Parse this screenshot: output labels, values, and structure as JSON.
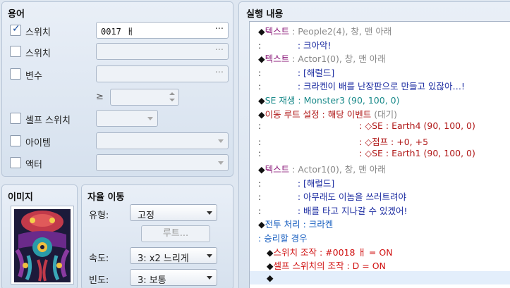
{
  "terms": {
    "title": "용어",
    "switch1": {
      "label": "스위치",
      "checked": true,
      "value": "0017 ㅐ"
    },
    "switch2": {
      "label": "스위치"
    },
    "variable": {
      "label": "변수",
      "ge": "≥"
    },
    "self_switch": {
      "label": "셀프 스위치"
    },
    "item": {
      "label": "아이템"
    },
    "actor": {
      "label": "액터"
    },
    "dots": "···"
  },
  "image": {
    "title": "이미지"
  },
  "autonomous": {
    "title": "자율 이동",
    "type_label": "유형:",
    "type_value": "고정",
    "route_button": "루트...",
    "speed_label": "속도:",
    "speed_value": "3: x2 느리게",
    "freq_label": "빈도:",
    "freq_value": "3: 보통"
  },
  "contents": {
    "title": "실행 내용",
    "lines": [
      {
        "parts": [
          {
            "t": "◆",
            "c": "#111"
          },
          {
            "t": "텍스트",
            "c": "#8b1a7a"
          },
          {
            "t": " : People2(4), 창, 맨 아래",
            "c": "#888"
          }
        ]
      },
      {
        "parts": [
          {
            "t": ":",
            "c": "#333"
          },
          {
            "t": "             : 크아악!",
            "c": "#1a2aa0"
          }
        ]
      },
      {
        "parts": [
          {
            "t": "◆",
            "c": "#111"
          },
          {
            "t": "텍스트",
            "c": "#8b1a7a"
          },
          {
            "t": " : Actor1(0), 창, 맨 아래",
            "c": "#888"
          }
        ]
      },
      {
        "parts": [
          {
            "t": ":",
            "c": "#333"
          },
          {
            "t": "             : [해럴드]",
            "c": "#1a2aa0"
          }
        ]
      },
      {
        "parts": [
          {
            "t": ":",
            "c": "#333"
          },
          {
            "t": "             : 크라켄이 배를 난장판으로 만들고 있잖아…!",
            "c": "#1a2aa0"
          }
        ]
      },
      {
        "parts": [
          {
            "t": "◆",
            "c": "#111"
          },
          {
            "t": "SE 재생 : Monster3 (90, 100, 0)",
            "c": "#1a8a8a"
          }
        ]
      },
      {
        "parts": [
          {
            "t": "◆",
            "c": "#111"
          },
          {
            "t": "이동 루트 설정 : 해당 이벤트",
            "c": "#b01818"
          },
          {
            "t": " (대기)",
            "c": "#888"
          }
        ]
      },
      {
        "parts": [
          {
            "t": ":",
            "c": "#333"
          },
          {
            "t": "                                   : ◇SE : Earth4 (90, 100, 0)",
            "c": "#b01818"
          }
        ]
      },
      {
        "parts": [
          {
            "t": ":",
            "c": "#333"
          },
          {
            "t": "                                   : ◇점프 : +0, +5",
            "c": "#b01818"
          }
        ]
      },
      {
        "parts": [
          {
            "t": ":",
            "c": "#333"
          },
          {
            "t": "                                   : ◇SE : Earth1 (90, 100, 0)",
            "c": "#b01818"
          }
        ]
      },
      {
        "parts": [
          {
            "t": "◆",
            "c": "#111"
          },
          {
            "t": "텍스트",
            "c": "#8b1a7a"
          },
          {
            "t": " : Actor1(0), 창, 맨 아래",
            "c": "#888"
          }
        ]
      },
      {
        "parts": [
          {
            "t": ":",
            "c": "#333"
          },
          {
            "t": "             : [해럴드]",
            "c": "#1a2aa0"
          }
        ]
      },
      {
        "parts": [
          {
            "t": ":",
            "c": "#333"
          },
          {
            "t": "             : 아무래도 이놈을 쓰러트려야",
            "c": "#1a2aa0"
          }
        ]
      },
      {
        "parts": [
          {
            "t": ":",
            "c": "#333"
          },
          {
            "t": "             : 배를 타고 지나갈 수 있겠어!",
            "c": "#1a2aa0"
          }
        ]
      },
      {
        "parts": [
          {
            "t": "◆",
            "c": "#111"
          },
          {
            "t": "전투 처리 : 크라켄",
            "c": "#1a60c0"
          }
        ]
      },
      {
        "parts": [
          {
            "t": ": ",
            "c": "#1a60c0"
          },
          {
            "t": "승리할 경우",
            "c": "#1a60c0"
          }
        ]
      },
      {
        "parts": [
          {
            "t": "   ◆",
            "c": "#111"
          },
          {
            "t": "스위치 조작 : #0018 ㅐ = ON",
            "c": "#d01010"
          }
        ]
      },
      {
        "parts": [
          {
            "t": "   ◆",
            "c": "#111"
          },
          {
            "t": "셀프 스위치의 조작 : D = ON",
            "c": "#d01010"
          }
        ]
      },
      {
        "parts": [
          {
            "t": "   ◆",
            "c": "#111"
          }
        ]
      }
    ]
  },
  "colors": {
    "accent": "#1a4fa0"
  },
  "icons": [
    "check-icon",
    "ellipsis-icon",
    "chevron-down-icon",
    "spin-up-icon",
    "spin-down-icon"
  ]
}
